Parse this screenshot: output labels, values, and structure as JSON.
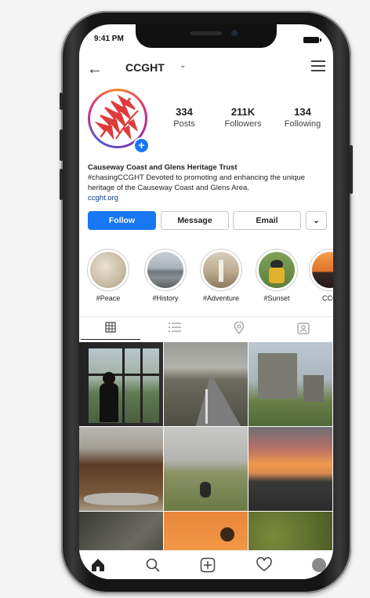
{
  "status": {
    "time": "9:41 PM"
  },
  "header": {
    "username": "CCGHT"
  },
  "profile": {
    "stats": [
      {
        "value": "334",
        "label": "Posts"
      },
      {
        "value": "211K",
        "label": "Followers"
      },
      {
        "value": "134",
        "label": "Following"
      }
    ],
    "name": "Causeway Coast and Glens Heritage Trust",
    "bio": "#chasingCCGHT Devoted to promoting and enhancing the unique heritage of the Causeway Coast and Glens Area.",
    "website": "ccght.org"
  },
  "actions": {
    "follow": "Follow",
    "message": "Message",
    "email": "Email"
  },
  "highlights": [
    {
      "label": "#Peace"
    },
    {
      "label": "#History"
    },
    {
      "label": "#Adventure"
    },
    {
      "label": "#Sunset"
    },
    {
      "label": "CCG"
    }
  ],
  "colors": {
    "accent": "#1877f2",
    "avatar_leaf": "#e03a3a"
  },
  "icons": {
    "tabs": [
      "grid-icon",
      "list-icon",
      "location-pin-icon",
      "tagged-icon"
    ],
    "nav": [
      "home-icon",
      "search-icon",
      "new-post-icon",
      "heart-icon",
      "profile-icon"
    ]
  }
}
